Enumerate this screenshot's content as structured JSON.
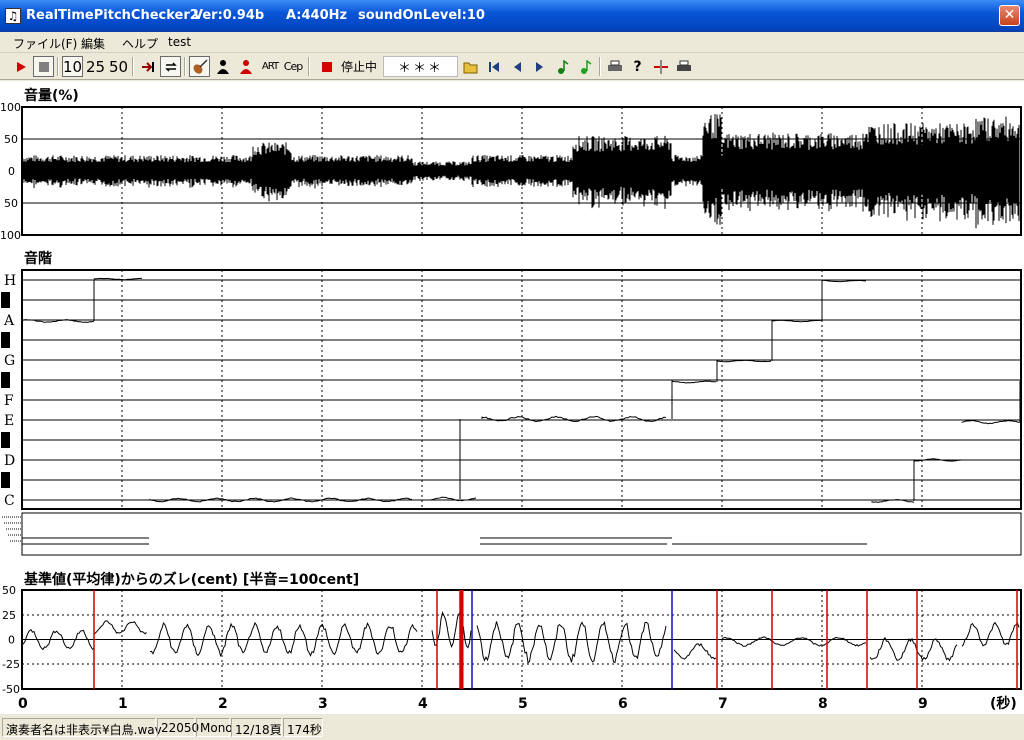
{
  "window": {
    "app_name": "RealTimePitchChecker2",
    "version": "Ver:0.94b",
    "a_freq": "A:440Hz",
    "sound_on_level": "soundOnLevel:10",
    "close_glyph": "✕"
  },
  "menu": {
    "file": "ファイル(F)",
    "edit": "編集",
    "help": "ヘルプ",
    "test": "test"
  },
  "toolbar": {
    "speed1": "10",
    "speed2": "25",
    "speed3": "50",
    "art": "ART",
    "cep": "Cep",
    "status": "停止中",
    "note_display": "＊＊＊",
    "icons": [
      "play-icon",
      "stop-icon",
      "skip-end-icon",
      "loop-icon",
      "violin-icon",
      "person-icon",
      "person-red-icon",
      "record-icon",
      "open-folder-icon",
      "first-icon",
      "prev-icon",
      "next-icon",
      "note-icon",
      "note2-icon",
      "print-icon",
      "help-icon",
      "marker-icon",
      "print2-icon"
    ]
  },
  "volume_panel": {
    "title": "音量(%)",
    "ticks": [
      "100",
      "50",
      "0",
      "50",
      "100"
    ]
  },
  "scale_panel": {
    "title": "音階",
    "notes": [
      "H",
      "A",
      "G",
      "F",
      "E",
      "D",
      "C"
    ]
  },
  "deviation_panel": {
    "title": "基準値(平均律)からのズレ(cent) [半音=100cent]",
    "ticks": [
      "50",
      "25",
      "0",
      "-25",
      "-50"
    ]
  },
  "time_axis": {
    "labels": [
      "0",
      "1",
      "2",
      "3",
      "4",
      "5",
      "6",
      "7",
      "8",
      "9"
    ],
    "unit": "(秒)"
  },
  "statusbar": {
    "file": "演奏者名は非表示¥白鳥.wav",
    "rate": "22050",
    "channels": "Mono",
    "page": "12/18頁",
    "duration": "174秒"
  },
  "colors": {
    "accent_red": "#d00000",
    "accent_blue": "#1010c0",
    "trace": "#000000"
  }
}
